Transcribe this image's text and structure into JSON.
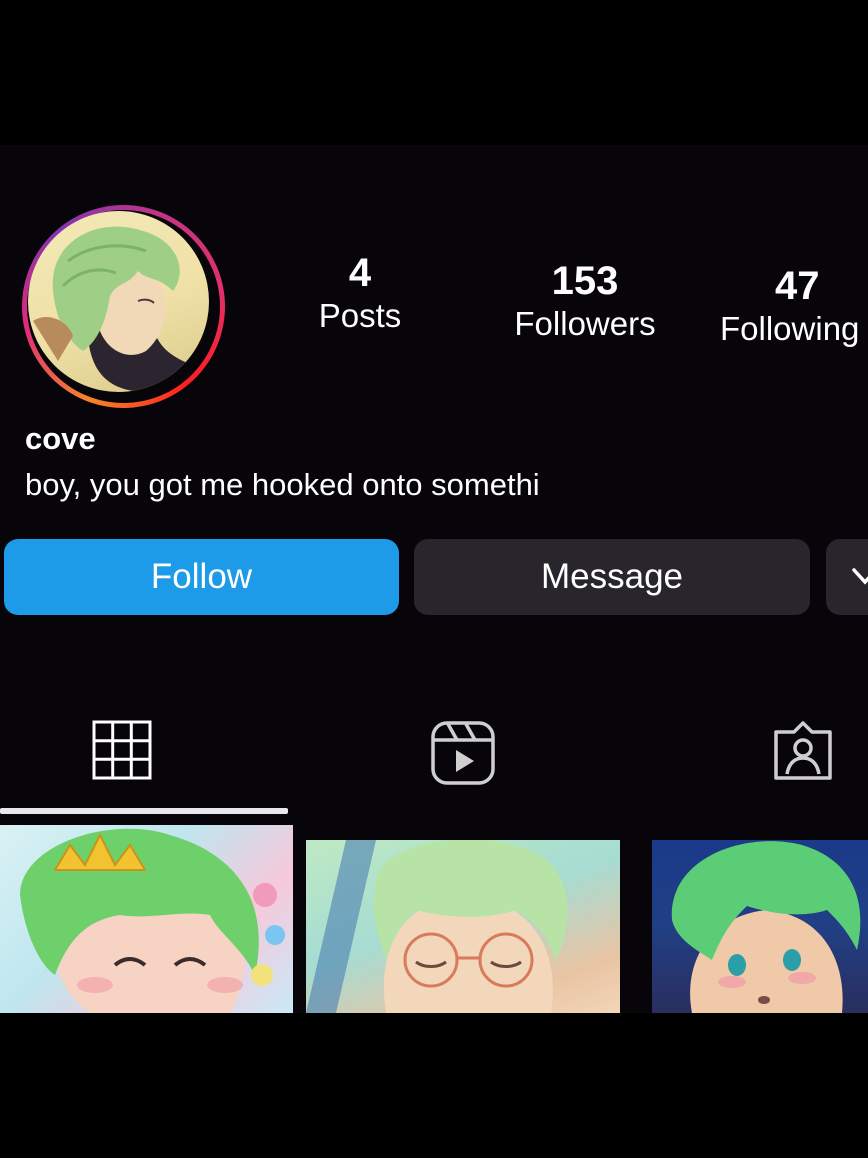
{
  "profile": {
    "username": "cove",
    "bio": "boy, you got me hooked onto somethi",
    "avatar_icon": "profile-picture"
  },
  "stats": {
    "posts": {
      "value": "4",
      "label": "Posts"
    },
    "followers": {
      "value": "153",
      "label": "Followers"
    },
    "following": {
      "value": "47",
      "label": "Following"
    }
  },
  "actions": {
    "follow_label": "Follow",
    "message_label": "Message",
    "more_icon": "chevron-down-icon"
  },
  "tabs": [
    {
      "name": "grid",
      "icon": "grid-icon",
      "active": true
    },
    {
      "name": "reels",
      "icon": "reels-icon",
      "active": false
    },
    {
      "name": "tagged",
      "icon": "tagged-person-icon",
      "active": false
    }
  ],
  "colors": {
    "follow_button": "#1d9be8",
    "secondary_button": "#28262c",
    "background": "#07040a",
    "ring_start": "#f58529",
    "ring_end": "#dd2a7b"
  }
}
